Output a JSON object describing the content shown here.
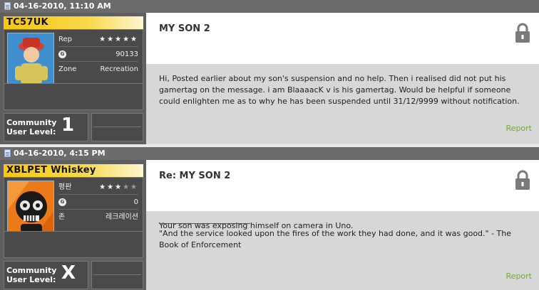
{
  "posts": [
    {
      "date": "04-16-2010, 11:10 AM",
      "gamertag": "TC57UK",
      "rep_label": "Rep",
      "rep_stars": 5,
      "rep_max": 5,
      "gamerscore": "90133",
      "zone_label": "Zone",
      "zone": "Recreation",
      "level_label_1": "Community",
      "level_label_2": "User Level:",
      "level": "1",
      "title": "MY SON 2",
      "body": "Hi, Posted earlier about my son's suspension and no help. Then i realised did not put his gamertag on the message. i am BlaaaacK v is his gamertag. Would be helpful if someone could enlighten me as to why he has been suspended until 31/12/9999 without notification.",
      "report": "Report",
      "colors": {
        "namebar_start": "#f6c80a",
        "namebar_end": "#fff4c2"
      }
    },
    {
      "date": "04-16-2010, 4:15 PM",
      "gamertag": "XBLPET Whiskey",
      "rep_label": "평판",
      "rep_stars": 3,
      "rep_max": 5,
      "gamerscore": "0",
      "zone_label": "존",
      "zone": "레크레이션",
      "level_label_1": "Community",
      "level_label_2": "User Level:",
      "level": "X",
      "title": "Re: MY SON 2",
      "body": "Your son was exposing himself on camera in Uno.",
      "signature": "\"And the service looked upon the fires of the work they had done, and it was good.\" - The Book of Enforcement",
      "report": "Report",
      "colors": {
        "namebar_start": "#f6c80a",
        "namebar_end": "#fff4c2"
      }
    }
  ]
}
